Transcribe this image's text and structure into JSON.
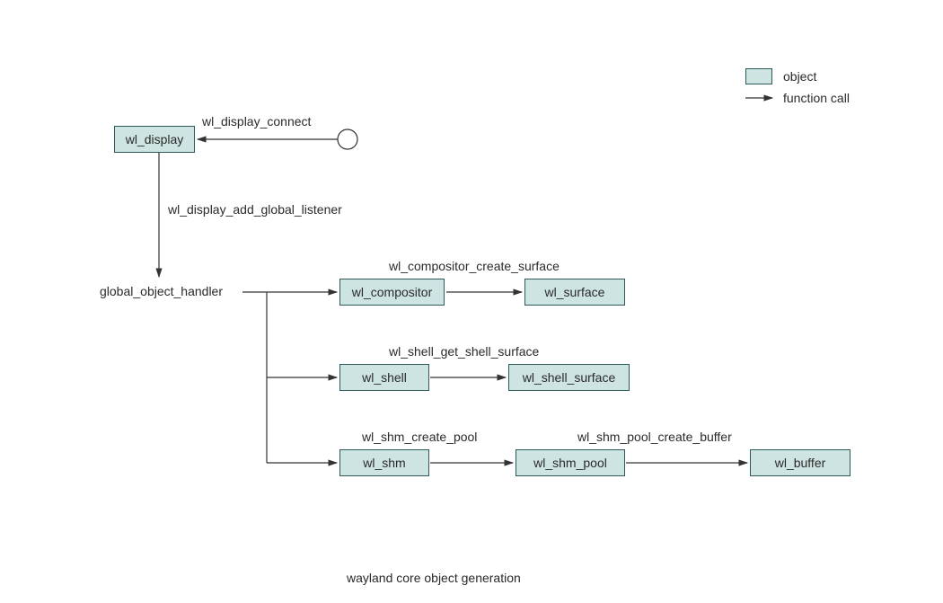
{
  "nodes": {
    "wl_display": "wl_display",
    "wl_compositor": "wl_compositor",
    "wl_surface": "wl_surface",
    "wl_shell": "wl_shell",
    "wl_shell_surface": "wl_shell_surface",
    "wl_shm": "wl_shm",
    "wl_shm_pool": "wl_shm_pool",
    "wl_buffer": "wl_buffer"
  },
  "handler": "global_object_handler",
  "edges": {
    "connect": "wl_display_connect",
    "add_listener": "wl_display_add_global_listener",
    "create_surface": "wl_compositor_create_surface",
    "get_shell_surface": "wl_shell_get_shell_surface",
    "create_pool": "wl_shm_create_pool",
    "create_buffer": "wl_shm_pool_create_buffer"
  },
  "legend": {
    "object": "object",
    "function_call": "function call"
  },
  "caption": "wayland core object generation"
}
